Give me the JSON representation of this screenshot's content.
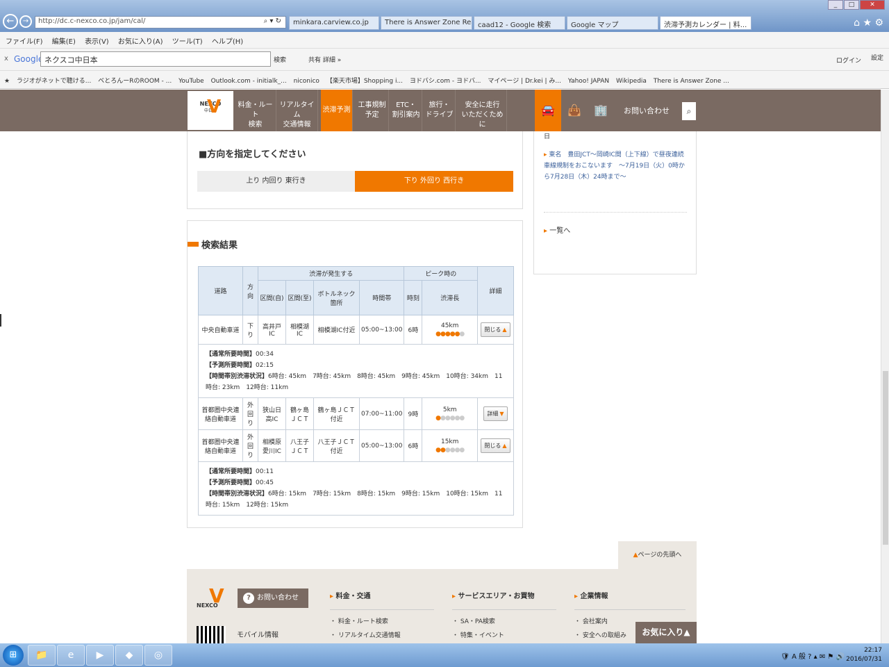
{
  "browser": {
    "address": "http://dc.c-nexco.co.jp/jam/cal/",
    "tabs": [
      {
        "label": "minkara.carview.co.jp"
      },
      {
        "label": "There is Answer Zone Real..."
      },
      {
        "label": "caad12 - Google 検索"
      },
      {
        "label": "Google マップ"
      },
      {
        "label": "渋滞予測カレンダー | 料..."
      }
    ],
    "menu": [
      "ファイル(F)",
      "編集(E)",
      "表示(V)",
      "お気に入り(A)",
      "ツール(T)",
      "ヘルプ(H)"
    ],
    "google_bar": {
      "logo": "Google",
      "query": "ネクスコ中日本",
      "search": "検索",
      "share": "共有",
      "more": "詳細 »",
      "login": "ログイン",
      "settings": "設定"
    },
    "favorites": [
      "ラジオがネットで聴ける...",
      "べとろんーRのROOM - ...",
      "YouTube",
      "Outlook.com - initialk_...",
      "niconico",
      "【楽天市場】Shopping i...",
      "ヨドバシ.com - ヨドバ...",
      "マイページ | Dr.kei | み...",
      "Yahoo! JAPAN",
      "Wikipedia",
      "There is Answer Zone ..."
    ]
  },
  "site_nav": {
    "logo": "NEXCO",
    "logo_sub": "中日本",
    "items": [
      "料金・ルート\n検索",
      "リアルタイム\n交通情報",
      "渋滞予測",
      "工事規制\n予定",
      "ETC・\n割引案内",
      "旅行・\nドライブ",
      "安全に走行\nいただくために"
    ],
    "contact": "お問い合わせ"
  },
  "direction": {
    "title": "■方向を指定してください",
    "up": "上り 内回り 東行き",
    "down": "下り 外回り 西行き"
  },
  "results": {
    "title": "検索結果",
    "headers": {
      "road": "道路",
      "dir": "方向",
      "occur": "渋滞が発生する",
      "from": "区間(自)",
      "to": "区間(至)",
      "bottleneck": "ボトルネック箇所",
      "time_range": "時間帯",
      "peak": "ピーク時の",
      "time": "時刻",
      "length": "渋滞長",
      "detail": "詳細"
    },
    "rows": [
      {
        "road": "中央自動車道",
        "dir": "下り",
        "from": "高井戸IC",
        "to": "相模湖IC",
        "bottleneck": "相模湖IC付近",
        "time_range": "05:00~13:00",
        "peak": "6時",
        "length": "45km",
        "level": 5,
        "button": "閉じる",
        "details": {
          "normal_label": "【通常所要時間】",
          "normal": "00:34",
          "forecast_label": "【予測所要時間】",
          "forecast": "02:15",
          "hourly_label": "【時間帯別渋滞状況】",
          "hourly": "6時台: 45km　7時台: 45km　8時台: 45km　9時台: 45km　10時台: 34km　11時台: 23km　12時台: 11km"
        }
      },
      {
        "road": "首都圏中央連絡自動車道",
        "dir": "外回り",
        "from": "狭山日高IC",
        "to": "鶴ヶ島ＪＣＴ",
        "bottleneck": "鶴ヶ島ＪＣＴ付近",
        "time_range": "07:00~11:00",
        "peak": "9時",
        "length": "5km",
        "level": 1,
        "button": "詳細"
      },
      {
        "road": "首都圏中央連絡自動車道",
        "dir": "外回り",
        "from": "相模原愛川IC",
        "to": "八王子ＪＣＴ",
        "bottleneck": "八王子ＪＣＴ付近",
        "time_range": "05:00~13:00",
        "peak": "6時",
        "length": "15km",
        "level": 2,
        "button": "閉じる",
        "details": {
          "normal_label": "【通常所要時間】",
          "normal": "00:11",
          "forecast_label": "【予測所要時間】",
          "forecast": "00:45",
          "hourly_label": "【時間帯別渋滞状況】",
          "hourly": "6時台: 15km　7時台: 15km　8時台: 15km　9時台: 15km　10時台: 15km　11時台: 15km　12時台: 15km"
        }
      }
    ]
  },
  "sidebar": {
    "date_tail": "日",
    "news": "東名　豊田JCT～岡崎IC間（上下線）で昼夜連続車線規制をおこないます　～7月19日（火）0時から7月28日（木）24時まで～",
    "list_link": "一覧へ"
  },
  "page_top": "ページの先頭へ",
  "footer": {
    "contact": "お問い合わせ",
    "mobile": "モバイル情報",
    "col1": {
      "title": "料金・交通",
      "i1": "料金・ルート検索",
      "i2": "リアルタイム交通情報"
    },
    "col2": {
      "title": "サービスエリア・お買物",
      "i1": "SA・PA検索",
      "i2": "特集・イベント"
    },
    "col3": {
      "title": "企業情報",
      "i1": "会社案内",
      "i2": "安全への取組み"
    },
    "enter": "お気に入り"
  },
  "taskbar": {
    "time": "22:17",
    "date": "2016/07/31"
  }
}
